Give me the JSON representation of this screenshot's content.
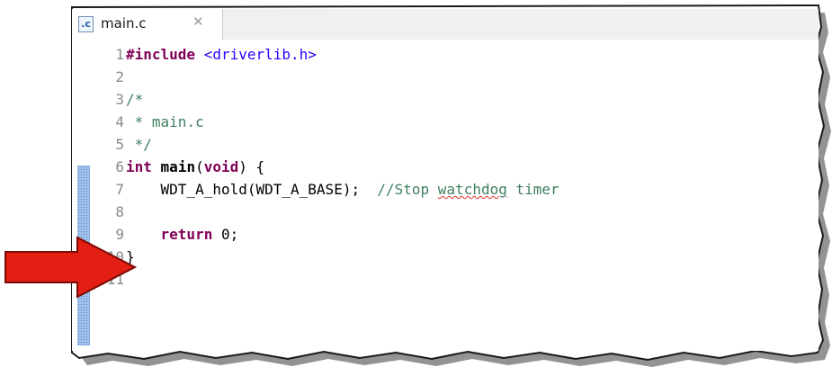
{
  "editor": {
    "tab_label": "main.c",
    "tab_close_glyph": "✕",
    "file_icon_glyph": ".c",
    "file_icon": "c-source-file-icon"
  },
  "code": {
    "lines": [
      {
        "number": "1",
        "tokens": [
          [
            "kw",
            "#include"
          ],
          [
            "plain",
            " "
          ],
          [
            "inc",
            "<driverlib.h>"
          ]
        ]
      },
      {
        "number": "2",
        "tokens": []
      },
      {
        "number": "3",
        "tokens": [
          [
            "cm",
            "/*"
          ]
        ]
      },
      {
        "number": "4",
        "tokens": [
          [
            "cm",
            " * main.c"
          ]
        ]
      },
      {
        "number": "5",
        "tokens": [
          [
            "cm",
            " */"
          ]
        ]
      },
      {
        "number": "6",
        "tokens": [
          [
            "kw",
            "int"
          ],
          [
            "plain",
            " "
          ],
          [
            "fn",
            "main"
          ],
          [
            "plain",
            "("
          ],
          [
            "kw",
            "void"
          ],
          [
            "plain",
            ") {"
          ]
        ]
      },
      {
        "number": "7",
        "tokens": [
          [
            "plain",
            "    WDT_A_hold(WDT_A_BASE);  "
          ],
          [
            "cm",
            "//Stop "
          ],
          [
            "cm-squiggle",
            "watchdog"
          ],
          [
            "cm",
            " timer"
          ]
        ]
      },
      {
        "number": "8",
        "tokens": []
      },
      {
        "number": "9",
        "tokens": [
          [
            "plain",
            "    "
          ],
          [
            "kw",
            "return"
          ],
          [
            "plain",
            " 0;"
          ]
        ]
      },
      {
        "number": "10",
        "tokens": [
          [
            "plain",
            "}"
          ]
        ]
      },
      {
        "number": "11",
        "tokens": []
      }
    ]
  },
  "colors": {
    "keyword": "#7f0055",
    "include_path": "#2a00ff",
    "comment": "#3f7f5f",
    "line_number": "#8a8a8a",
    "arrow": "#e31e12",
    "change_marker": "#a9c7ea"
  },
  "annotation": {
    "arrow_icon": "red-right-arrow-icon",
    "points_to_line": "8"
  }
}
